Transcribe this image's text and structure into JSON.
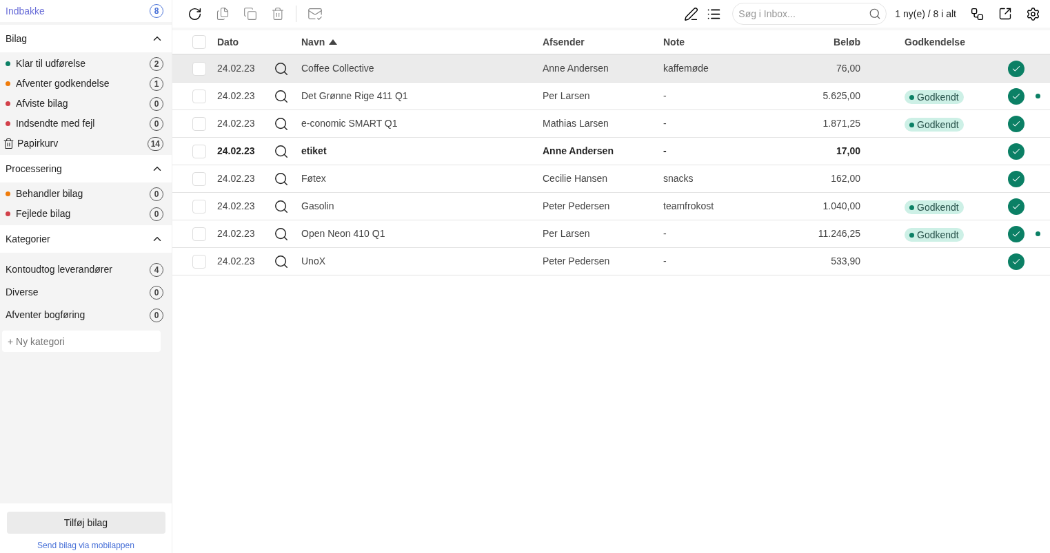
{
  "sidebar": {
    "inbox": {
      "label": "Indbakke",
      "count": "8",
      "selected": true
    },
    "sections": [
      {
        "title": "Bilag",
        "expanded": true,
        "items": [
          {
            "kind": "status",
            "label": "Klar til udførelse",
            "count": "2",
            "color": "#0b8065"
          },
          {
            "kind": "status",
            "label": "Afventer godkendelse",
            "count": "1",
            "color": "#f07c0a"
          },
          {
            "kind": "status",
            "label": "Afviste bilag",
            "count": "0",
            "color": "#d2404a"
          },
          {
            "kind": "status",
            "label": "Indsendte med fejl",
            "count": "0",
            "color": "#d2404a"
          },
          {
            "kind": "trash",
            "label": "Papirkurv",
            "count": "14"
          }
        ]
      },
      {
        "title": "Processering",
        "expanded": true,
        "items": [
          {
            "kind": "status",
            "label": "Behandler bilag",
            "count": "0",
            "color": "#f07c0a"
          },
          {
            "kind": "status",
            "label": "Fejlede bilag",
            "count": "0",
            "color": "#d2404a"
          }
        ]
      },
      {
        "title": "Kategorier",
        "expanded": true,
        "items": [
          {
            "kind": "category",
            "label": "Kontoudtog leverandører",
            "count": "4"
          },
          {
            "kind": "category",
            "label": "Diverse",
            "count": "0"
          },
          {
            "kind": "category",
            "label": "Afventer bogføring",
            "count": "0"
          }
        ]
      }
    ],
    "new_category": {
      "placeholder": "+ Ny kategori"
    },
    "add_button": "Tilføj bilag",
    "mobile_link": "Send bilag via mobilappen"
  },
  "toolbar": {
    "search": {
      "placeholder": "Søg i Inbox..."
    },
    "counter": "1 ny(e) / 8 i alt"
  },
  "table": {
    "all_checked": false,
    "columns": [
      {
        "label": "Dato",
        "sorted": false
      },
      {
        "label": "Navn",
        "sorted": true
      },
      {
        "label": "Afsender",
        "sorted": false
      },
      {
        "label": "Note",
        "sorted": false
      },
      {
        "label": "Beløb",
        "sorted": false
      },
      {
        "label": "Godkendelse",
        "sorted": false
      }
    ],
    "rows": [
      {
        "date": "24.02.23",
        "name": "Coffee Collective",
        "sender": "Anne Andersen",
        "note": "kaffemøde",
        "amount": "76,00",
        "approval": null,
        "unread": false,
        "selected": true,
        "checked": false,
        "flag": false
      },
      {
        "date": "24.02.23",
        "name": "Det Grønne Rige 411 Q1",
        "sender": "Per Larsen",
        "note": "-",
        "amount": "5.625,00",
        "approval": "Godkendt",
        "unread": false,
        "selected": false,
        "checked": false,
        "flag": true
      },
      {
        "date": "24.02.23",
        "name": "e-conomic SMART Q1",
        "sender": "Mathias Larsen",
        "note": "-",
        "amount": "1.871,25",
        "approval": "Godkendt",
        "unread": false,
        "selected": false,
        "checked": false,
        "flag": false
      },
      {
        "date": "24.02.23",
        "name": "etiket",
        "sender": "Anne Andersen",
        "note": "-",
        "amount": "17,00",
        "approval": null,
        "unread": true,
        "selected": false,
        "checked": false,
        "flag": false
      },
      {
        "date": "24.02.23",
        "name": "Føtex",
        "sender": "Cecilie Hansen",
        "note": "snacks",
        "amount": "162,00",
        "approval": null,
        "unread": false,
        "selected": false,
        "checked": false,
        "flag": false
      },
      {
        "date": "24.02.23",
        "name": "Gasolin",
        "sender": "Peter Pedersen",
        "note": "teamfrokost",
        "amount": "1.040,00",
        "approval": "Godkendt",
        "unread": false,
        "selected": false,
        "checked": false,
        "flag": false
      },
      {
        "date": "24.02.23",
        "name": "Open Neon 410 Q1",
        "sender": "Per Larsen",
        "note": "-",
        "amount": "11.246,25",
        "approval": "Godkendt",
        "unread": false,
        "selected": false,
        "checked": false,
        "flag": true
      },
      {
        "date": "24.02.23",
        "name": "UnoX",
        "sender": "Peter Pedersen",
        "note": "-",
        "amount": "533,90",
        "approval": null,
        "unread": false,
        "selected": false,
        "checked": false,
        "flag": false
      }
    ]
  }
}
